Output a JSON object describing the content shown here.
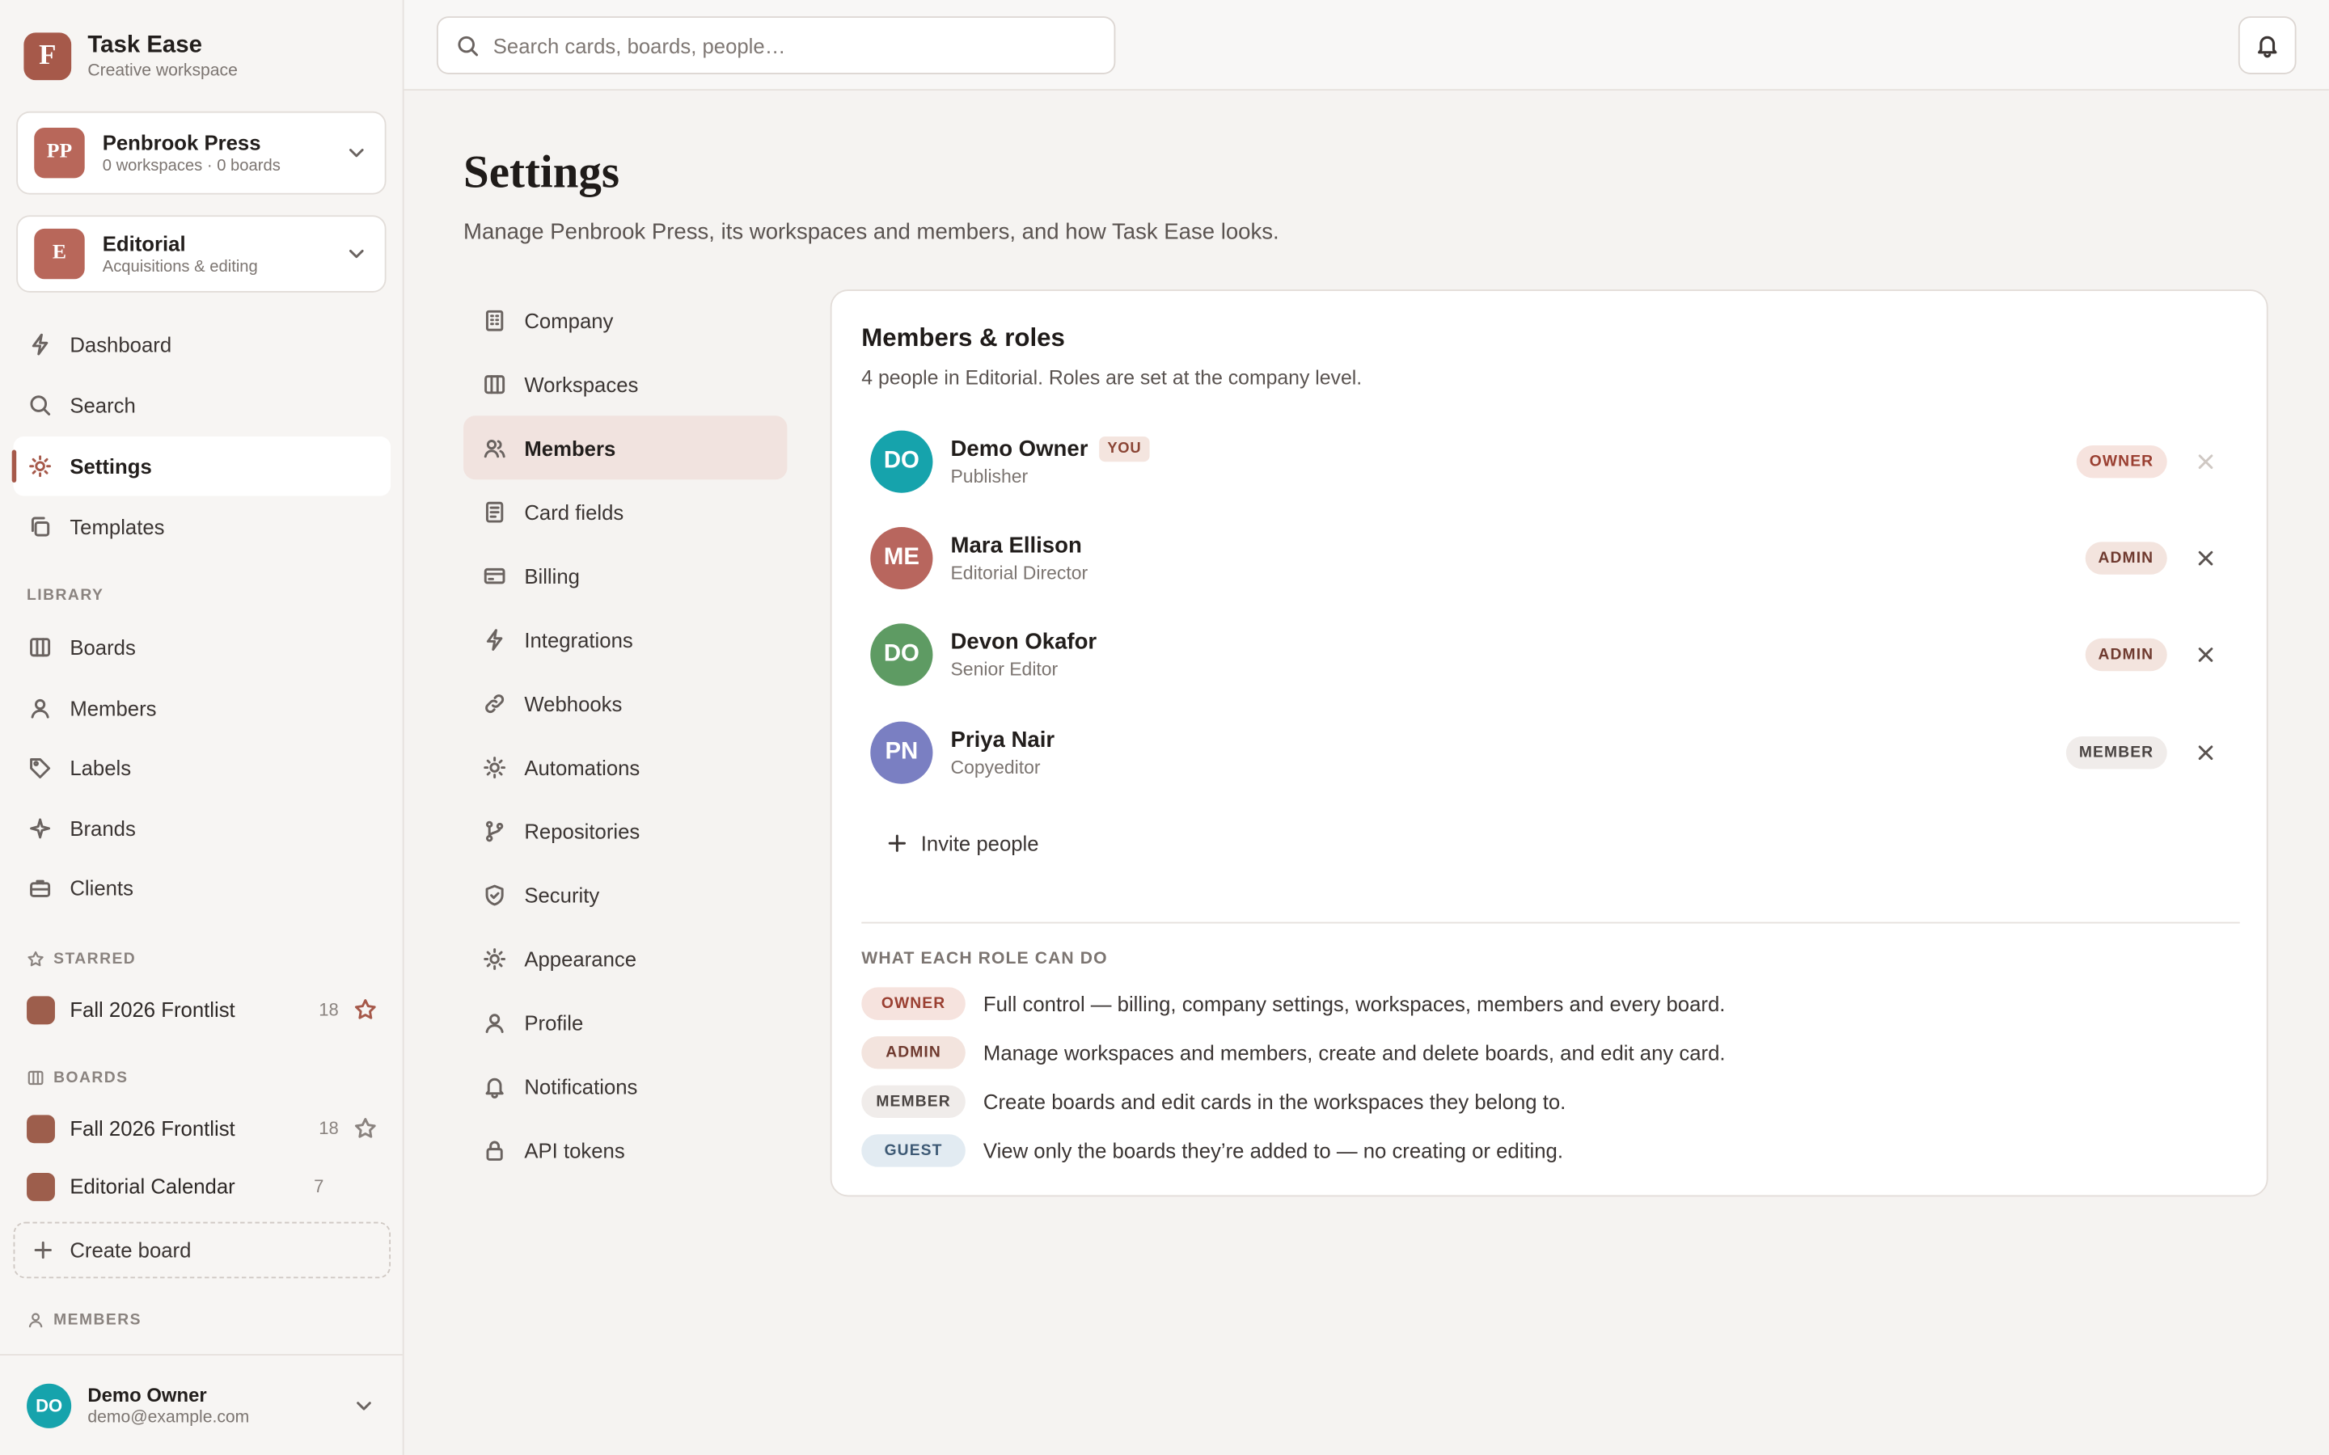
{
  "app": {
    "name": "Task Ease",
    "subtitle": "Creative workspace",
    "logo_letter": "F"
  },
  "company": {
    "initials": "PP",
    "name": "Penbrook Press",
    "meta": "0 workspaces · 0 boards"
  },
  "workspace": {
    "initials": "E",
    "name": "Editorial",
    "meta": "Acquisitions & editing"
  },
  "nav": {
    "main": [
      {
        "label": "Dashboard",
        "icon": "bolt-icon"
      },
      {
        "label": "Search",
        "icon": "search-icon"
      },
      {
        "label": "Settings",
        "icon": "sun-icon",
        "active": true
      },
      {
        "label": "Templates",
        "icon": "copy-icon"
      }
    ],
    "library_label": "LIBRARY",
    "library": [
      {
        "label": "Boards",
        "icon": "columns-icon"
      },
      {
        "label": "Members",
        "icon": "user-icon"
      },
      {
        "label": "Labels",
        "icon": "tag-icon"
      },
      {
        "label": "Brands",
        "icon": "sparkle-icon"
      },
      {
        "label": "Clients",
        "icon": "briefcase-icon"
      }
    ],
    "starred_label": "STARRED",
    "starred": [
      {
        "name": "Fall 2026 Frontlist",
        "count": "18",
        "starred": true
      }
    ],
    "boards_label": "BOARDS",
    "boards": [
      {
        "name": "Fall 2026 Frontlist",
        "count": "18",
        "starred": false
      },
      {
        "name": "Editorial Calendar",
        "count": "7"
      }
    ],
    "create_board": "Create board",
    "members_label": "MEMBERS"
  },
  "user": {
    "initials": "DO",
    "name": "Demo Owner",
    "email": "demo@example.com"
  },
  "topbar": {
    "search_placeholder": "Search cards, boards, people…"
  },
  "page": {
    "title": "Settings",
    "subtitle": "Manage Penbrook Press, its workspaces and members, and how Task Ease looks."
  },
  "settings_nav": [
    {
      "label": "Company",
      "icon": "building-icon"
    },
    {
      "label": "Workspaces",
      "icon": "columns-icon"
    },
    {
      "label": "Members",
      "icon": "users-icon",
      "active": true
    },
    {
      "label": "Card fields",
      "icon": "document-icon"
    },
    {
      "label": "Billing",
      "icon": "credit-card-icon"
    },
    {
      "label": "Integrations",
      "icon": "bolt-icon"
    },
    {
      "label": "Webhooks",
      "icon": "link-icon"
    },
    {
      "label": "Automations",
      "icon": "sun-icon"
    },
    {
      "label": "Repositories",
      "icon": "git-branch-icon"
    },
    {
      "label": "Security",
      "icon": "shield-icon"
    },
    {
      "label": "Appearance",
      "icon": "sun-icon"
    },
    {
      "label": "Profile",
      "icon": "user-icon"
    },
    {
      "label": "Notifications",
      "icon": "bell-icon"
    },
    {
      "label": "API tokens",
      "icon": "lock-icon"
    }
  ],
  "members_card": {
    "title": "Members & roles",
    "subtitle": "4 people in Editorial. Roles are set at the company level.",
    "you_badge": "YOU",
    "members": [
      {
        "initials": "DO",
        "name": "Demo Owner",
        "role_title": "Publisher",
        "role": "OWNER",
        "color": "#16a3ac",
        "you": true
      },
      {
        "initials": "ME",
        "name": "Mara Ellison",
        "role_title": "Editorial Director",
        "role": "ADMIN",
        "color": "#b8665e"
      },
      {
        "initials": "DO",
        "name": "Devon Okafor",
        "role_title": "Senior Editor",
        "role": "ADMIN",
        "color": "#5e9b63"
      },
      {
        "initials": "PN",
        "name": "Priya Nair",
        "role_title": "Copyeditor",
        "role": "MEMBER",
        "color": "#7a7fc2"
      }
    ],
    "invite_label": "Invite people",
    "permissions_label": "WHAT EACH ROLE CAN DO",
    "permissions": [
      {
        "role": "OWNER",
        "desc": "Full control — billing, company settings, workspaces, members and every board."
      },
      {
        "role": "ADMIN",
        "desc": "Manage workspaces and members, create and delete boards, and edit any card."
      },
      {
        "role": "MEMBER",
        "desc": "Create boards and edit cards in the workspaces they belong to."
      },
      {
        "role": "GUEST",
        "desc": "View only the boards they’re added to — no creating or editing."
      }
    ]
  },
  "colors": {
    "accent": "#a6594a",
    "active_bg": "#f1e3df"
  }
}
